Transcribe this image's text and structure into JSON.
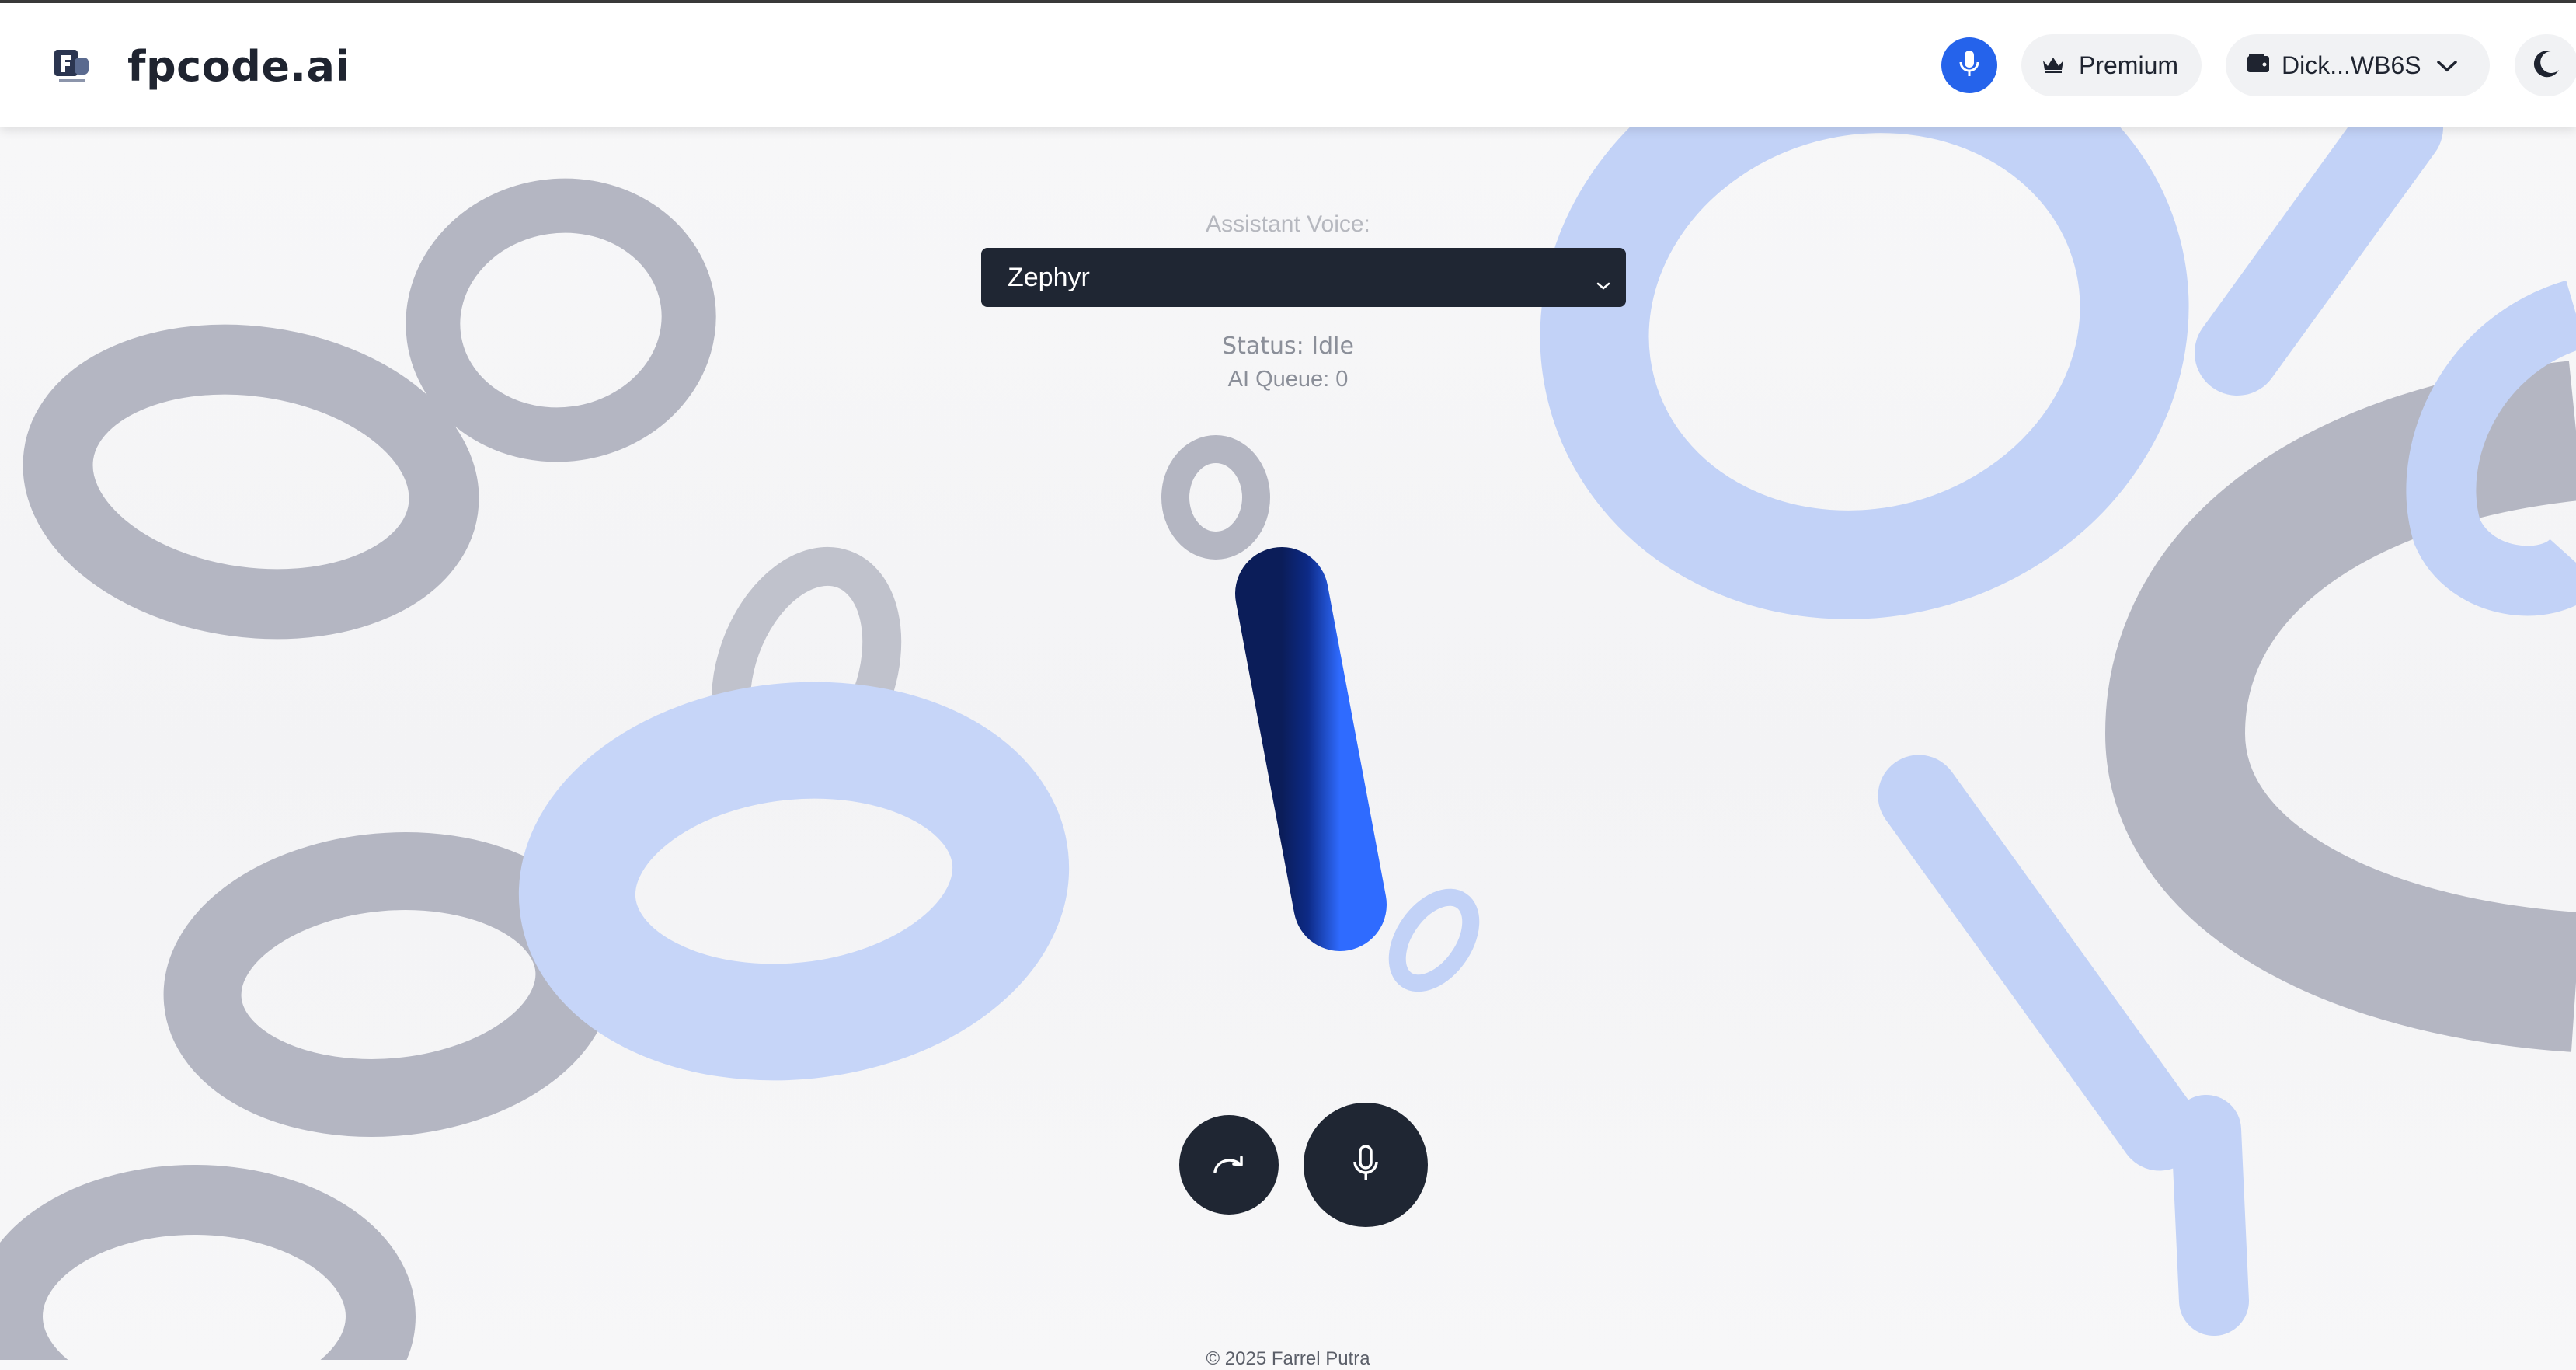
{
  "header": {
    "brand": "fpcode.ai",
    "premium_label": "Premium",
    "wallet_label": "Dick...WB6S"
  },
  "controls": {
    "voice_label": "Assistant Voice:",
    "voice_selected": "Zephyr",
    "status_text": "Status: Idle",
    "queue_text": "AI Queue: 0"
  },
  "footer": {
    "copyright": "© 2025 Farrel Putra"
  },
  "icons": {
    "logo": "fp-logo-icon",
    "mic": "microphone-icon",
    "premium": "crown-icon",
    "wallet": "wallet-icon",
    "wallet_menu": "chevron-down-icon",
    "theme": "moon-icon",
    "redo": "redo-arrow-icon",
    "record": "microphone-icon"
  },
  "colors": {
    "accent": "#2563eb",
    "dark": "#1f2633",
    "ring_gray": "#b4b6c2",
    "ring_blue": "#c2d2f7"
  }
}
